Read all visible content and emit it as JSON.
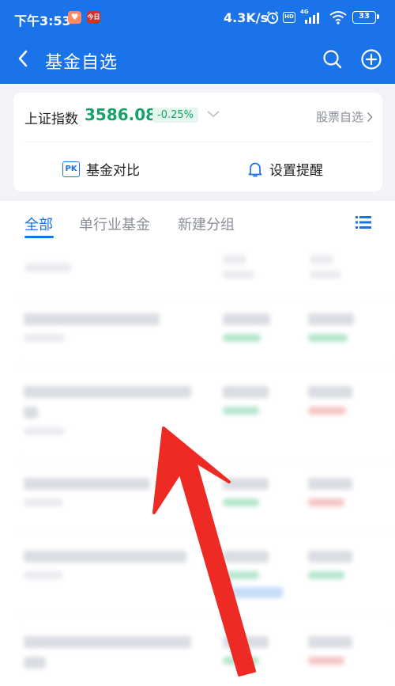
{
  "status_bar": {
    "time": "下午3:53",
    "badge_news": "今日",
    "net_speed": "4.3K/s",
    "hd": "HD",
    "signal": "4G",
    "battery": "33"
  },
  "header": {
    "title": "基金自选",
    "back_icon": "chevron-left-icon",
    "search_icon": "search-icon",
    "add_icon": "plus-circle-icon",
    "color": "#1a73e8"
  },
  "index_card": {
    "name": "上证指数",
    "value": "3586.08",
    "change": "-0.25%",
    "link": "股票自选",
    "actions": [
      {
        "label": "基金对比",
        "icon": "pk-icon"
      },
      {
        "label": "设置提醒",
        "icon": "bell-icon"
      }
    ],
    "accent_green": "#13a368"
  },
  "tabs": [
    {
      "label": "全部",
      "active": true
    },
    {
      "label": "单行业基金",
      "active": false
    },
    {
      "label": "新建分组",
      "active": false
    }
  ],
  "annotation": {
    "type": "red-arrow",
    "color": "#ee2a24"
  }
}
